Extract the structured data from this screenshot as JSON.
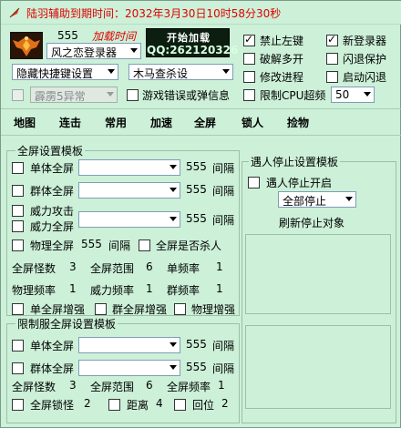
{
  "title": "陆羽辅助到期时间：2032年3月30日10时58分30秒",
  "top": {
    "code": "555",
    "load_time": "加载时间",
    "banner_line1": "开始加载",
    "banner_line2": "QQ:262120326",
    "login_combo": "风之恋登录器",
    "hide_shortcut_combo": "隐藏快捷键设置",
    "trojan_combo": "木马查杀设",
    "thunder_combo": "霹雳5异常",
    "game_error_label": "游戏错误或弹信息"
  },
  "options": {
    "ban_left_click": "禁止左键",
    "new_login": "新登录器",
    "crack_multi": "破解多开",
    "flash_protect": "闪退保护",
    "modify_process": "修改进程",
    "start_flash": "启动闪退",
    "limit_cpu": "限制CPU超频",
    "cpu_value": "50"
  },
  "menu": [
    "地图",
    "连击",
    "常用",
    "加速",
    "全屏",
    "锁人",
    "捡物"
  ],
  "fullscreen": {
    "group_title": "全屏设置模板",
    "single_label": "单体全屏",
    "single_value": "555",
    "interval_label": "间隔",
    "group_label": "群体全屏",
    "group_value": "555",
    "power_attack": "威力攻击",
    "power_full": "威力全屏",
    "power_value": "555",
    "physics_full": "物理全屏",
    "physics_value": "555",
    "kill_all": "全屏是否杀人",
    "count_label": "全屏怪数",
    "count_value": "3",
    "range_label": "全屏范围",
    "range_value": "6",
    "single_freq_label": "单频率",
    "single_freq_value": "1",
    "phys_freq_label": "物理频率",
    "phys_freq_value": "1",
    "power_freq_label": "威力频率",
    "power_freq_value": "1",
    "group_freq_label": "群频率",
    "group_freq_value": "1",
    "single_boost": "单全屏增强",
    "group_boost": "群全屏增强",
    "physics_boost": "物理增强"
  },
  "limited": {
    "group_title": "限制服全屏设置模板",
    "single_label": "单体全屏",
    "single_value": "555",
    "interval_label": "间隔",
    "group_label": "群体全屏",
    "group_value": "555",
    "count_label": "全屏怪数",
    "count_value": "3",
    "range_label": "全屏范围",
    "range_value": "6",
    "freq_label": "全屏频率",
    "freq_value": "1",
    "lock_label": "全屏锁怪",
    "lock_value": "2",
    "distance_label": "距离",
    "distance_value": "4",
    "return_label": "回位",
    "return_value": "2"
  },
  "encounter": {
    "group_title": "遇人停止设置模板",
    "enable_label": "遇人停止开启",
    "stop_combo": "全部停止",
    "refresh_label": "刷新停止对象"
  }
}
